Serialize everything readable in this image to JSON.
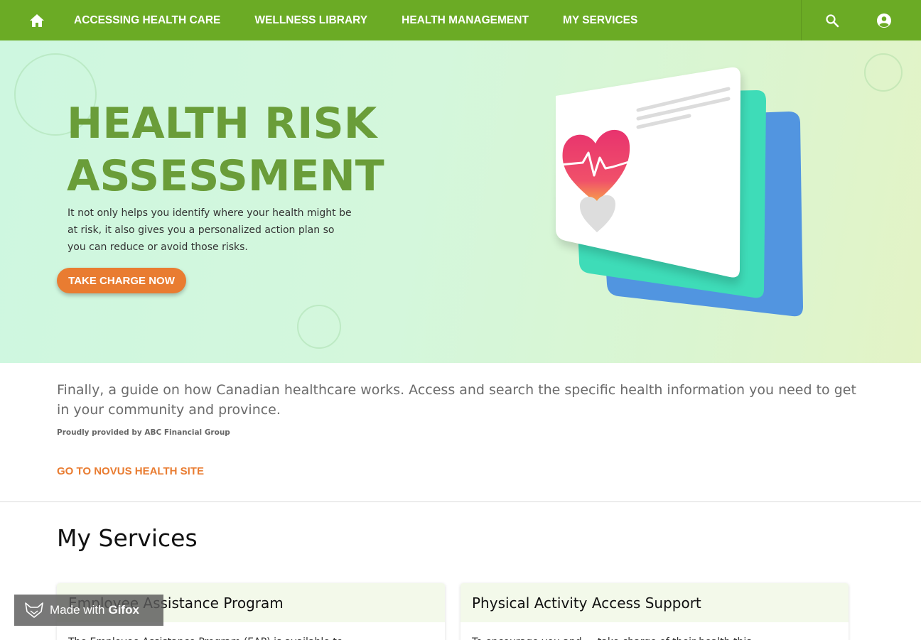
{
  "nav": {
    "items": [
      "ACCESSING HEALTH CARE",
      "WELLNESS LIBRARY",
      "HEALTH MANAGEMENT",
      "MY SERVICES"
    ],
    "icons": {
      "home": "home-icon",
      "search": "search-icon",
      "account": "account-circle-icon"
    }
  },
  "hero": {
    "title_line1": "HEALTH RISK",
    "title_line2": "ASSESSMENT",
    "description": "It not only helps you identify where your health might be at risk, it also gives you a personalized action plan so you can reduce or avoid those risks.",
    "button": "TAKE CHARGE NOW"
  },
  "info": {
    "text": "Finally, a guide on how Canadian healthcare works. Access and search the specific health information you need to get in your community and province.",
    "provided_by": "Proudly provided by ABC Financial Group",
    "link": "GO TO NOVUS HEALTH SITE"
  },
  "services": {
    "title": "My Services",
    "cards": [
      {
        "title": "Employee Assistance Program",
        "body": "The Employee Assistance Program (EAP) is available to ..."
      },
      {
        "title": "Physical Activity Access Support",
        "body": "To encourage you and ... take charge of their health this ..."
      }
    ]
  },
  "watermark": {
    "prefix": "Made with",
    "brand": "Gifox"
  },
  "colors": {
    "nav": "#6bab25",
    "accent": "#e97c31",
    "title": "#6a9d39"
  }
}
